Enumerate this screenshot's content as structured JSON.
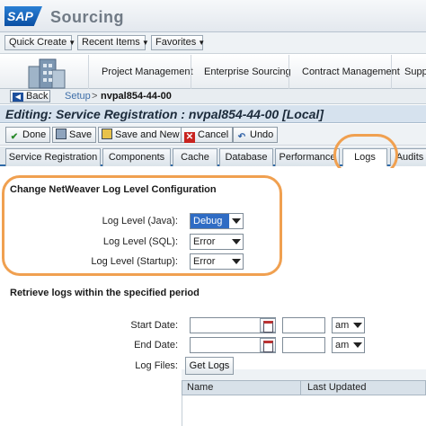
{
  "header": {
    "logo_text": "SAP",
    "app_title": "Sourcing"
  },
  "menubar": {
    "items": [
      {
        "label": "Quick Create"
      },
      {
        "label": "Recent Items"
      },
      {
        "label": "Favorites"
      }
    ]
  },
  "topnav": {
    "items": [
      {
        "label": "Project Management"
      },
      {
        "label": "Enterprise Sourcing"
      },
      {
        "label": "Contract Management"
      },
      {
        "label": "Suppl"
      }
    ]
  },
  "breadcrumb": {
    "back_label": "Back",
    "setup": "Setup",
    "separator": ">",
    "current": "nvpal854-44-00"
  },
  "editing_title": "Editing: Service Registration : nvpal854-44-00 [Local]",
  "toolbar": {
    "done": "Done",
    "save": "Save",
    "save_and_new": "Save and New",
    "cancel": "Cancel",
    "undo": "Undo"
  },
  "tabs": [
    {
      "label": "Service Registration"
    },
    {
      "label": "Components"
    },
    {
      "label": "Cache"
    },
    {
      "label": "Database"
    },
    {
      "label": "Performance"
    },
    {
      "label": "Logs",
      "active": true
    },
    {
      "label": "Audits"
    }
  ],
  "log_level_section": {
    "title": "Change NetWeaver Log Level Configuration",
    "java_label": "Log Level (Java):",
    "java_value": "Debug",
    "sql_label": "Log Level (SQL):",
    "sql_value": "Error",
    "startup_label": "Log Level (Startup):",
    "startup_value": "Error"
  },
  "retrieve_section": {
    "title": "Retrieve logs within the specified period",
    "start_date_label": "Start Date:",
    "start_date_value": "",
    "start_time_value": "",
    "start_ampm": "am",
    "end_date_label": "End Date:",
    "end_date_value": "",
    "end_time_value": "",
    "end_ampm": "am",
    "log_files_label": "Log Files:",
    "get_logs_label": "Get Logs",
    "columns": [
      "Name",
      "Last Updated"
    ]
  },
  "colors": {
    "highlight": "#f0a050",
    "accent": "#2f6aa8",
    "selected_option": "#2f6cc4"
  }
}
